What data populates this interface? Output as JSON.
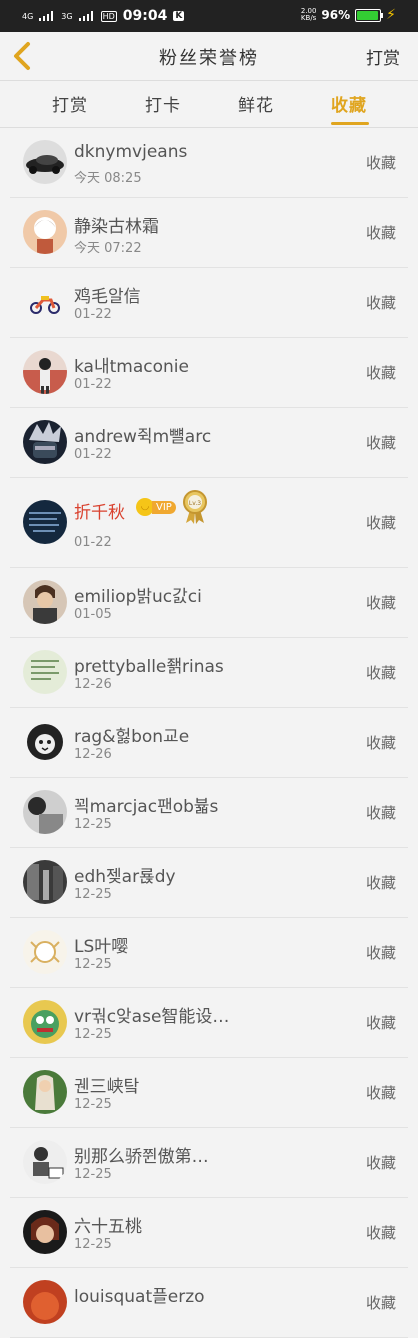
{
  "status_bar": {
    "signal1": "4G",
    "signal2": "3G",
    "hd": "HD",
    "time": "09:04",
    "app_badge": "K",
    "speed_top": "2.00",
    "speed_bottom": "KB/s",
    "battery_pct": "96%",
    "battery_level": 0.96
  },
  "header": {
    "title": "粉丝荣誉榜",
    "right_action": "打赏"
  },
  "tabs": [
    {
      "label": "打赏",
      "active": false
    },
    {
      "label": "打卡",
      "active": false
    },
    {
      "label": "鲜花",
      "active": false
    },
    {
      "label": "收藏",
      "active": true
    }
  ],
  "accent_color": "#e0a51f",
  "action_label": "收藏",
  "rows": [
    {
      "name": "dknymvjeans",
      "date": "今天 08:25"
    },
    {
      "name": "静染古林霜",
      "date": "今天 07:22"
    },
    {
      "name": "鸡毛알信",
      "date": "01-22"
    },
    {
      "name": "ka내tmaconie",
      "date": "01-22"
    },
    {
      "name": "andrew쥑m뺼arc",
      "date": "01-22"
    },
    {
      "name": "折千秋",
      "date": "01-22",
      "vip_label": "VIP",
      "medal_label": "Lv.3"
    },
    {
      "name": "emiliop밝uc갌ci",
      "date": "01-05"
    },
    {
      "name": "prettyballe좱rinas",
      "date": "12-26"
    },
    {
      "name": "rag&헗bon교e",
      "date": "12-26"
    },
    {
      "name": "꾁marcjac팬ob뷻s",
      "date": "12-25"
    },
    {
      "name": "edh젲ar룑dy",
      "date": "12-25"
    },
    {
      "name": "LS叶嘤",
      "date": "12-25"
    },
    {
      "name": "vr궊c앚ase智能设…",
      "date": "12-25"
    },
    {
      "name": "궨三峡탘",
      "date": "12-25"
    },
    {
      "name": "别那么骄쮠傲第…",
      "date": "12-25"
    },
    {
      "name": "六十五桃",
      "date": "12-25"
    },
    {
      "name": "louisquat플erzo",
      "date": ""
    }
  ]
}
